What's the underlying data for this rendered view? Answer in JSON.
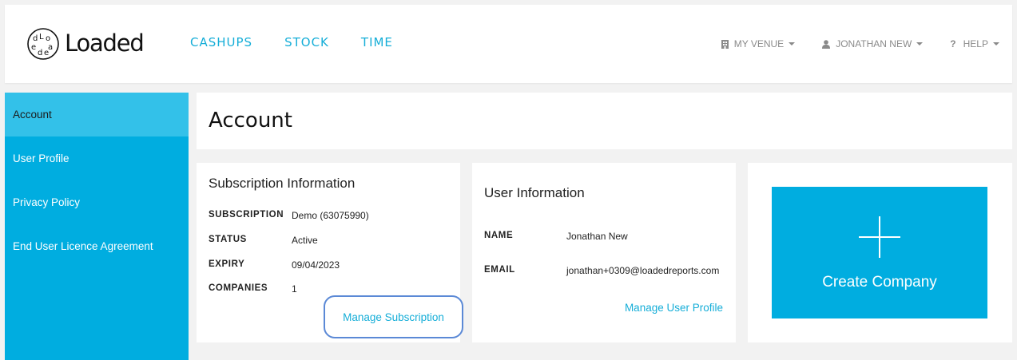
{
  "brand": {
    "name": "Loaded"
  },
  "nav": [
    {
      "label": "CASHUPS"
    },
    {
      "label": "STOCK"
    },
    {
      "label": "TIME"
    }
  ],
  "menu": {
    "venue": {
      "label": "MY VENUE",
      "icon": "building-icon"
    },
    "user": {
      "label": "JONATHAN NEW",
      "icon": "user-icon"
    },
    "help": {
      "label": "HELP",
      "icon": "question-icon",
      "glyph": "?"
    }
  },
  "sidebar": {
    "items": [
      {
        "label": "Account",
        "active": true
      },
      {
        "label": "User Profile"
      },
      {
        "label": "Privacy Policy"
      },
      {
        "label": "End User Licence Agreement"
      }
    ]
  },
  "page": {
    "title": "Account"
  },
  "subscription": {
    "title": "Subscription Information",
    "rows": [
      {
        "label": "SUBSCRIPTION",
        "value": "Demo (63075990)"
      },
      {
        "label": "STATUS",
        "value": "Active"
      },
      {
        "label": "EXPIRY",
        "value": "09/04/2023"
      },
      {
        "label": "COMPANIES",
        "value": "1"
      }
    ],
    "action": "Manage Subscription"
  },
  "user_info": {
    "title": "User Information",
    "rows": [
      {
        "label": "NAME",
        "value": "Jonathan New"
      },
      {
        "label": "EMAIL",
        "value": "jonathan+0309@loadedreports.com"
      }
    ],
    "action": "Manage User Profile"
  },
  "create_company": {
    "label": "Create Company"
  },
  "colors": {
    "accent": "#00ade0",
    "accent_light": "#33c1e9",
    "link": "#16aed8",
    "focus_ring": "#5b89d6",
    "background": "#f2f2f2"
  }
}
